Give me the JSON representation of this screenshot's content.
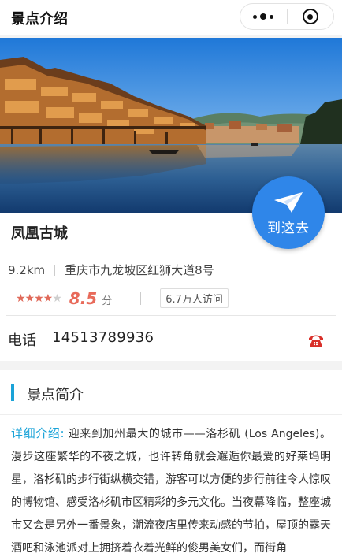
{
  "header": {
    "title": "景点介绍"
  },
  "spot": {
    "name": "凤凰古城",
    "go_label": "到这去",
    "distance": "9.2km",
    "address": "重庆市九龙坡区红狮大道8号",
    "rating_stars": 4,
    "rating_max": 5,
    "score": "8.5",
    "score_unit": "分",
    "visits": "6.7万人访问",
    "phone_label": "电话",
    "phone": "14513789936"
  },
  "intro": {
    "title": "景点简介",
    "highlight": "详细介绍:",
    "text": "迎来到加州最大的城市——洛杉矶 (Los Angeles)。漫步这座繁华的不夜之城，也许转角就会邂逅你最爱的好莱坞明星，洛杉矶的步行街纵横交错，游客可以方便的步行前往令人惊叹的博物馆、感受洛杉矶市区精彩的多元文化。当夜幕降临，整座城市又会是另外一番景象，潮流夜店里传来动感的节拍，屋顶的露天酒吧和泳池派对上拥挤着衣着光鲜的俊男美女们，而街角"
  },
  "colors": {
    "accent": "#1aa3d8",
    "button": "#2f86e9",
    "score": "#e86a5a",
    "phone_icon": "#d9302a"
  },
  "icons": [
    "more-dots-icon",
    "close-target-icon",
    "paper-plane-icon",
    "star-icon",
    "telephone-icon"
  ]
}
